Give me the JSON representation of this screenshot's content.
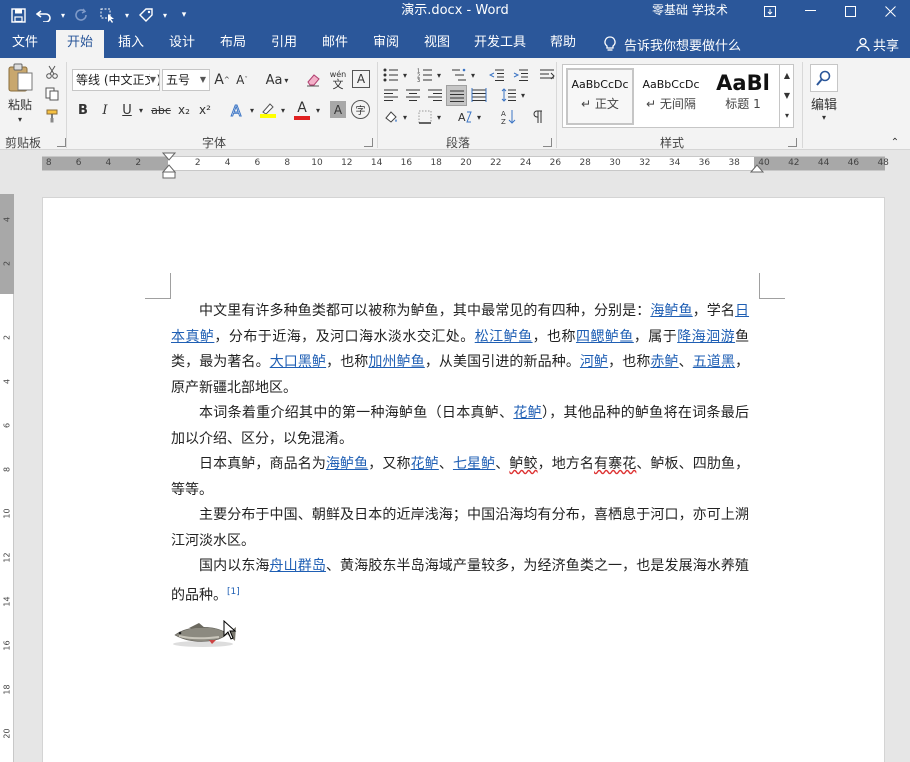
{
  "window": {
    "doc_title": "演示.docx  -  Word",
    "user": "零基础 学技术"
  },
  "tabs": [
    "文件",
    "开始",
    "插入",
    "设计",
    "布局",
    "引用",
    "邮件",
    "审阅",
    "视图",
    "开发工具",
    "帮助"
  ],
  "active_tab": "开始",
  "tell_me": "告诉我你想要做什么",
  "share": "共享",
  "ribbon": {
    "clipboard": {
      "label": "剪贴板",
      "paste": "粘贴"
    },
    "font": {
      "label": "字体",
      "font_name": "等线 (中文正文)",
      "font_size": "五号",
      "aa": "Aa",
      "bold": "B",
      "italic": "I",
      "underline": "U",
      "strike": "abc",
      "sub": "x₂",
      "sup": "x²",
      "pinyin": "wén",
      "border_char": "A",
      "shade_char": "A",
      "circle_char": "字",
      "highlight_color": "#ffff00",
      "font_color": "#e02020"
    },
    "paragraph": {
      "label": "段落"
    },
    "styles": {
      "label": "样式",
      "items": [
        {
          "preview": "AaBbCcDc",
          "name": "正文"
        },
        {
          "preview": "AaBbCcDc",
          "name": "无间隔"
        },
        {
          "preview": "AaBl",
          "name": "标题 1"
        }
      ]
    },
    "editing": {
      "label": "编辑"
    }
  },
  "ruler": {
    "numbers": [
      "8",
      "6",
      "4",
      "2",
      "2",
      "4",
      "6",
      "8",
      "10",
      "12",
      "14",
      "16",
      "18",
      "20",
      "22",
      "24",
      "26",
      "28",
      "30",
      "32",
      "34",
      "36",
      "38",
      "40",
      "42",
      "44",
      "46",
      "48"
    ],
    "vnumbers": [
      "4",
      "2",
      "2",
      "4",
      "6",
      "8",
      "10",
      "12",
      "14",
      "16",
      "18",
      "20"
    ]
  },
  "document": {
    "p1": [
      {
        "t": "中文里有许多种鱼类都可以被称为鲈鱼，其中最常见的有四种，分别是："
      },
      {
        "t": "海鲈鱼",
        "link": true
      },
      {
        "t": "，学名"
      },
      {
        "t": "日本真鲈",
        "link": true
      },
      {
        "t": "，分布于近海，及河口海水淡水交汇处。"
      },
      {
        "t": "松江鲈鱼",
        "link": true
      },
      {
        "t": "，也称"
      },
      {
        "t": "四鳃鲈鱼",
        "link": true
      },
      {
        "t": "，属于"
      },
      {
        "t": "降海洄游",
        "link": true
      },
      {
        "t": "鱼类，最为著名。"
      },
      {
        "t": "大口黑鲈",
        "link": true
      },
      {
        "t": "，也称"
      },
      {
        "t": "加州鲈鱼",
        "link": true
      },
      {
        "t": "，从美国引进的新品种。"
      },
      {
        "t": "河鲈",
        "link": true
      },
      {
        "t": "，也称"
      },
      {
        "t": "赤鲈",
        "link": true
      },
      {
        "t": "、"
      },
      {
        "t": "五道黑",
        "link": true
      },
      {
        "t": "，原产新疆北部地区。"
      }
    ],
    "p2": [
      {
        "t": "本词条着重介绍其中的第一种海鲈鱼（日本真鲈、"
      },
      {
        "t": "花鲈",
        "link": true
      },
      {
        "t": "），其他品种的鲈鱼将在词条最后加以介绍、区分，以免混淆。"
      }
    ],
    "p3": [
      {
        "t": "日本真鲈，商品名为"
      },
      {
        "t": "海鲈鱼",
        "link": true
      },
      {
        "t": "，又称"
      },
      {
        "t": "花鲈",
        "link": true
      },
      {
        "t": "、"
      },
      {
        "t": "七星鲈",
        "link": true
      },
      {
        "t": "、"
      },
      {
        "t": "鲈鲛",
        "wavy": true
      },
      {
        "t": "，地方名"
      },
      {
        "t": "有寨花",
        "wavy": true
      },
      {
        "t": "、鲈板、四肋鱼，等等。"
      }
    ],
    "p4": [
      {
        "t": "主要分布于中国、朝鲜及日本的近岸浅海；中国沿海均有分布，喜栖息于河口，亦可上溯江河淡水区。"
      }
    ],
    "p5": [
      {
        "t": "国内以东海"
      },
      {
        "t": "舟山群岛",
        "link": true
      },
      {
        "t": "、黄海胶东半岛海域产量较多，为经济鱼类之一，也是发展海水养殖的品种。"
      },
      {
        "t": "[1]",
        "fn": true
      }
    ]
  }
}
